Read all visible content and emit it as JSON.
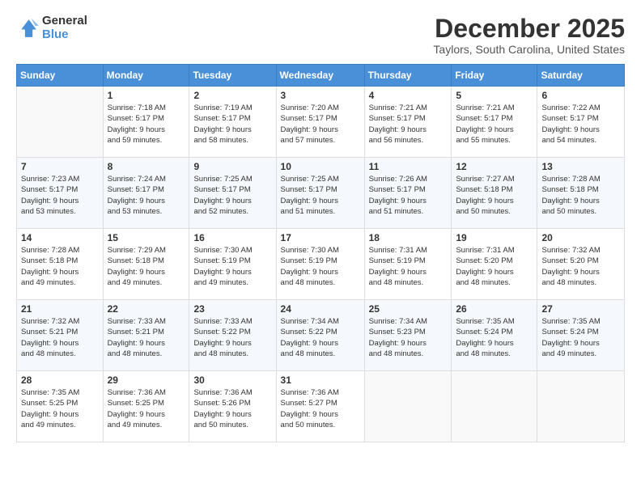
{
  "header": {
    "logo_general": "General",
    "logo_blue": "Blue",
    "month_title": "December 2025",
    "location": "Taylors, South Carolina, United States"
  },
  "weekdays": [
    "Sunday",
    "Monday",
    "Tuesday",
    "Wednesday",
    "Thursday",
    "Friday",
    "Saturday"
  ],
  "weeks": [
    [
      {
        "day": "",
        "info": ""
      },
      {
        "day": "1",
        "info": "Sunrise: 7:18 AM\nSunset: 5:17 PM\nDaylight: 9 hours\nand 59 minutes."
      },
      {
        "day": "2",
        "info": "Sunrise: 7:19 AM\nSunset: 5:17 PM\nDaylight: 9 hours\nand 58 minutes."
      },
      {
        "day": "3",
        "info": "Sunrise: 7:20 AM\nSunset: 5:17 PM\nDaylight: 9 hours\nand 57 minutes."
      },
      {
        "day": "4",
        "info": "Sunrise: 7:21 AM\nSunset: 5:17 PM\nDaylight: 9 hours\nand 56 minutes."
      },
      {
        "day": "5",
        "info": "Sunrise: 7:21 AM\nSunset: 5:17 PM\nDaylight: 9 hours\nand 55 minutes."
      },
      {
        "day": "6",
        "info": "Sunrise: 7:22 AM\nSunset: 5:17 PM\nDaylight: 9 hours\nand 54 minutes."
      }
    ],
    [
      {
        "day": "7",
        "info": "Sunrise: 7:23 AM\nSunset: 5:17 PM\nDaylight: 9 hours\nand 53 minutes."
      },
      {
        "day": "8",
        "info": "Sunrise: 7:24 AM\nSunset: 5:17 PM\nDaylight: 9 hours\nand 53 minutes."
      },
      {
        "day": "9",
        "info": "Sunrise: 7:25 AM\nSunset: 5:17 PM\nDaylight: 9 hours\nand 52 minutes."
      },
      {
        "day": "10",
        "info": "Sunrise: 7:25 AM\nSunset: 5:17 PM\nDaylight: 9 hours\nand 51 minutes."
      },
      {
        "day": "11",
        "info": "Sunrise: 7:26 AM\nSunset: 5:17 PM\nDaylight: 9 hours\nand 51 minutes."
      },
      {
        "day": "12",
        "info": "Sunrise: 7:27 AM\nSunset: 5:18 PM\nDaylight: 9 hours\nand 50 minutes."
      },
      {
        "day": "13",
        "info": "Sunrise: 7:28 AM\nSunset: 5:18 PM\nDaylight: 9 hours\nand 50 minutes."
      }
    ],
    [
      {
        "day": "14",
        "info": "Sunrise: 7:28 AM\nSunset: 5:18 PM\nDaylight: 9 hours\nand 49 minutes."
      },
      {
        "day": "15",
        "info": "Sunrise: 7:29 AM\nSunset: 5:18 PM\nDaylight: 9 hours\nand 49 minutes."
      },
      {
        "day": "16",
        "info": "Sunrise: 7:30 AM\nSunset: 5:19 PM\nDaylight: 9 hours\nand 49 minutes."
      },
      {
        "day": "17",
        "info": "Sunrise: 7:30 AM\nSunset: 5:19 PM\nDaylight: 9 hours\nand 48 minutes."
      },
      {
        "day": "18",
        "info": "Sunrise: 7:31 AM\nSunset: 5:19 PM\nDaylight: 9 hours\nand 48 minutes."
      },
      {
        "day": "19",
        "info": "Sunrise: 7:31 AM\nSunset: 5:20 PM\nDaylight: 9 hours\nand 48 minutes."
      },
      {
        "day": "20",
        "info": "Sunrise: 7:32 AM\nSunset: 5:20 PM\nDaylight: 9 hours\nand 48 minutes."
      }
    ],
    [
      {
        "day": "21",
        "info": "Sunrise: 7:32 AM\nSunset: 5:21 PM\nDaylight: 9 hours\nand 48 minutes."
      },
      {
        "day": "22",
        "info": "Sunrise: 7:33 AM\nSunset: 5:21 PM\nDaylight: 9 hours\nand 48 minutes."
      },
      {
        "day": "23",
        "info": "Sunrise: 7:33 AM\nSunset: 5:22 PM\nDaylight: 9 hours\nand 48 minutes."
      },
      {
        "day": "24",
        "info": "Sunrise: 7:34 AM\nSunset: 5:22 PM\nDaylight: 9 hours\nand 48 minutes."
      },
      {
        "day": "25",
        "info": "Sunrise: 7:34 AM\nSunset: 5:23 PM\nDaylight: 9 hours\nand 48 minutes."
      },
      {
        "day": "26",
        "info": "Sunrise: 7:35 AM\nSunset: 5:24 PM\nDaylight: 9 hours\nand 48 minutes."
      },
      {
        "day": "27",
        "info": "Sunrise: 7:35 AM\nSunset: 5:24 PM\nDaylight: 9 hours\nand 49 minutes."
      }
    ],
    [
      {
        "day": "28",
        "info": "Sunrise: 7:35 AM\nSunset: 5:25 PM\nDaylight: 9 hours\nand 49 minutes."
      },
      {
        "day": "29",
        "info": "Sunrise: 7:36 AM\nSunset: 5:25 PM\nDaylight: 9 hours\nand 49 minutes."
      },
      {
        "day": "30",
        "info": "Sunrise: 7:36 AM\nSunset: 5:26 PM\nDaylight: 9 hours\nand 50 minutes."
      },
      {
        "day": "31",
        "info": "Sunrise: 7:36 AM\nSunset: 5:27 PM\nDaylight: 9 hours\nand 50 minutes."
      },
      {
        "day": "",
        "info": ""
      },
      {
        "day": "",
        "info": ""
      },
      {
        "day": "",
        "info": ""
      }
    ]
  ]
}
